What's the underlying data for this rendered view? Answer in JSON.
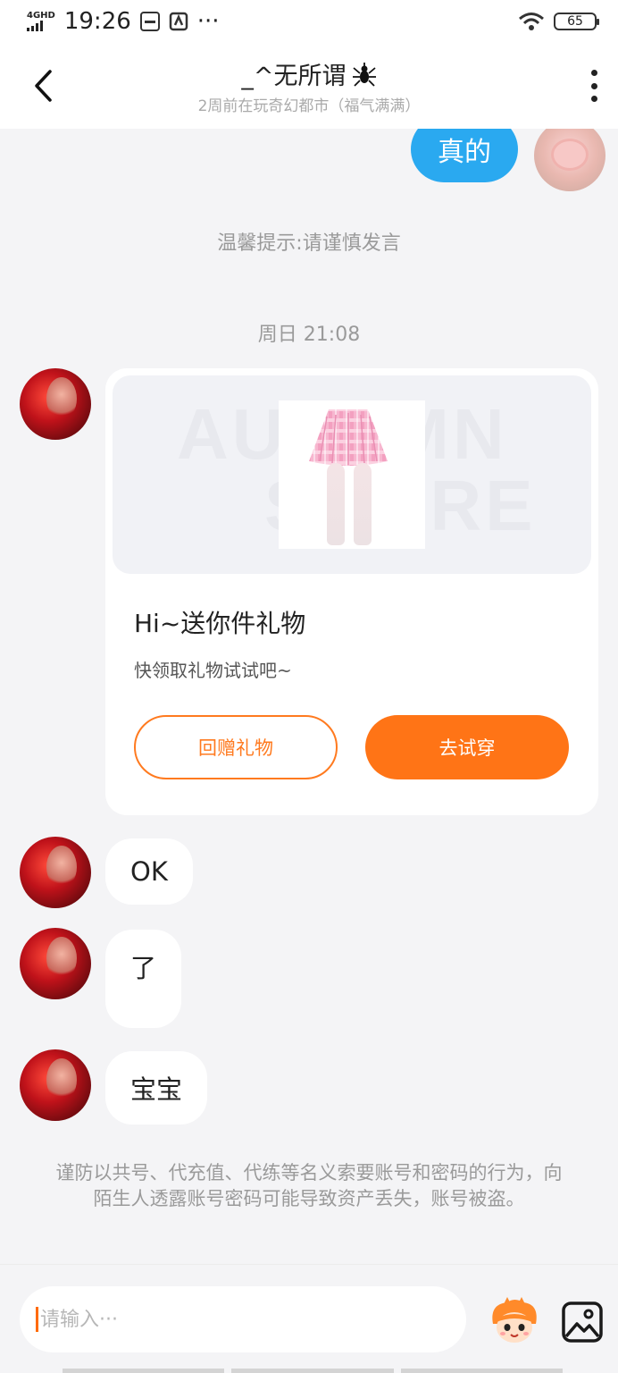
{
  "status_bar": {
    "network": "4GHD",
    "time": "19:26",
    "more": "···",
    "battery": "65"
  },
  "header": {
    "title": "_^无所谓",
    "subtitle": "2周前在玩奇幻都市（福气满满）"
  },
  "messages": {
    "outgoing_text": "真的",
    "tip": "温馨提示:请谨慎发言",
    "timestamp": "周日 21:08",
    "gift_card": {
      "watermark_line1": "AUTUMN",
      "watermark_line2": "SCORE",
      "title": "Hi~送你件礼物",
      "subtitle": "快领取礼物试试吧~",
      "return_gift_label": "回赠礼物",
      "try_on_label": "去试穿"
    },
    "incoming": [
      "OK",
      "了",
      "宝宝"
    ]
  },
  "warning": "谨防以共号、代充值、代练等名义索要账号和密码的行为，向陌生人透露账号密码可能导致资产丢失，账号被盗。",
  "input": {
    "placeholder": "请输入···"
  },
  "colors": {
    "accent_orange": "#ff7416",
    "bubble_blue": "#2aa9f0",
    "background": "#f4f4f6"
  },
  "icons": [
    "back-arrow-icon",
    "more-vertical-icon",
    "spider-icon",
    "wifi-icon",
    "battery-icon",
    "mascot-emoji-icon",
    "image-icon"
  ]
}
